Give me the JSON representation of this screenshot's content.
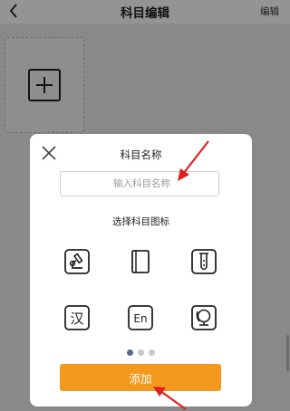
{
  "header": {
    "title": "科目编辑",
    "edit_label": "编辑"
  },
  "dialog": {
    "title": "科目名称",
    "name_input_placeholder": "输入科目名称",
    "icon_section_label": "选择科目图标",
    "icons": [
      "microscope-icon",
      "book-icon",
      "test-tube-icon",
      "chinese-character-icon",
      "english-icon",
      "globe-icon"
    ],
    "icon_texts": {
      "english": "En",
      "chinese": "汉"
    },
    "page_dots": {
      "count": 3,
      "active_index": 0
    },
    "add_button_label": "添加"
  },
  "colors": {
    "accent": "#f39a1e",
    "annotation_arrow": "#e02020",
    "active_dot": "#5a6b8a"
  }
}
